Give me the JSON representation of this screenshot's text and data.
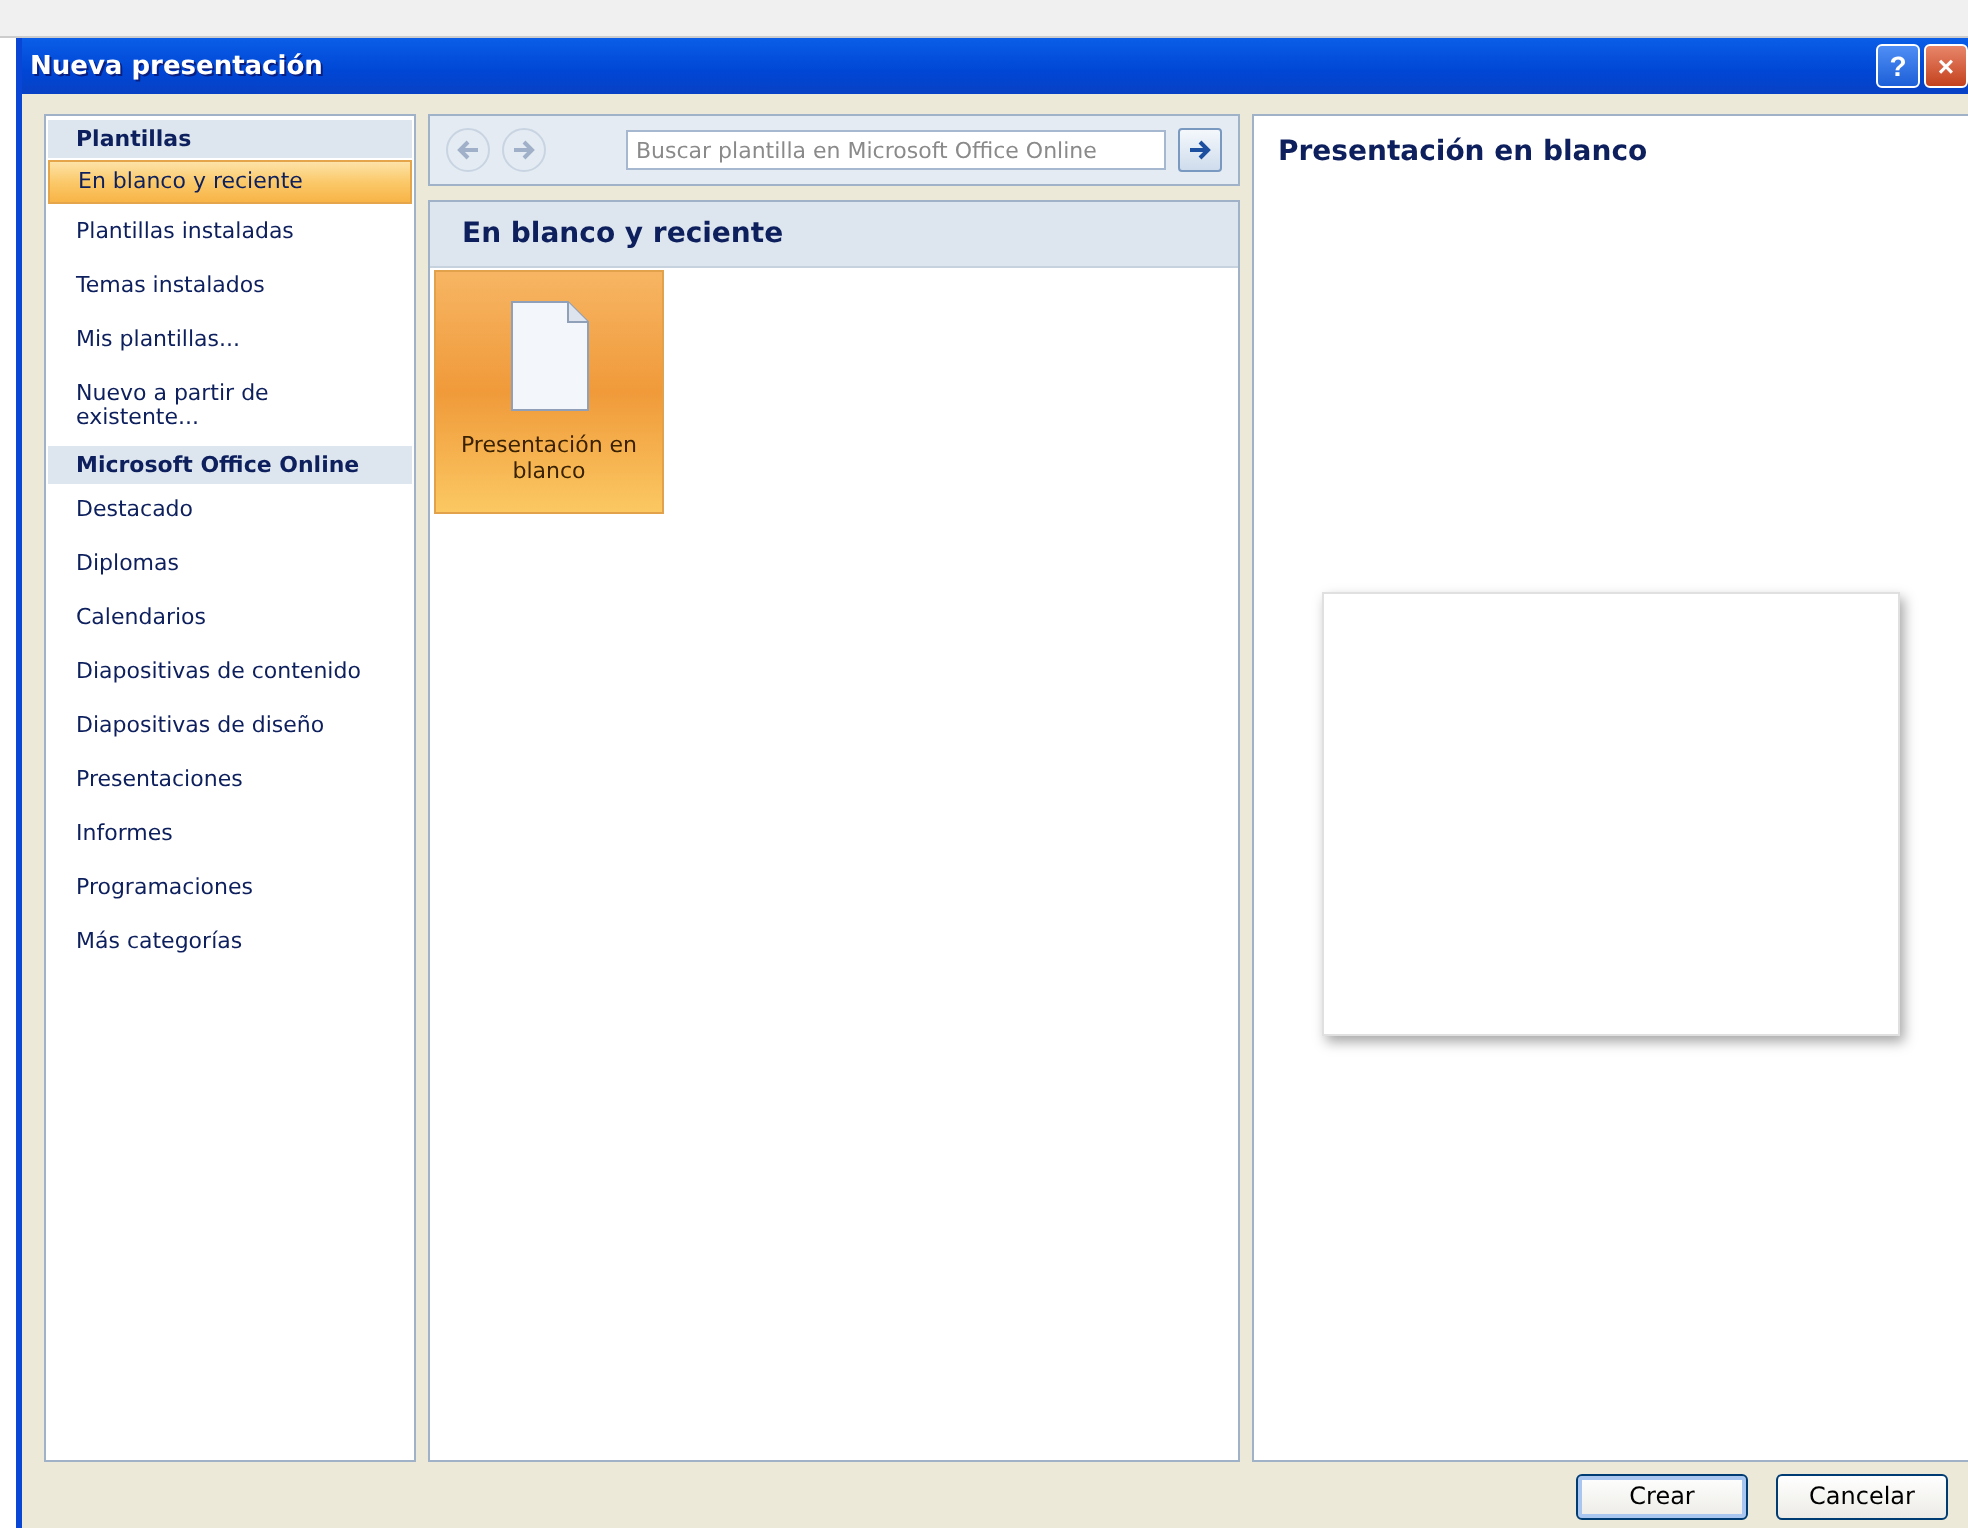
{
  "window": {
    "title": "Nueva presentación",
    "help": "?",
    "close": "×"
  },
  "sidebar": {
    "items": [
      {
        "kind": "header",
        "label": "Plantillas"
      },
      {
        "kind": "item",
        "label": "En blanco y reciente",
        "selected": true
      },
      {
        "kind": "item",
        "label": "Plantillas instaladas",
        "selected": false
      },
      {
        "kind": "item",
        "label": "Temas instalados",
        "selected": false
      },
      {
        "kind": "item",
        "label": "Mis plantillas...",
        "selected": false
      },
      {
        "kind": "item",
        "label": "Nuevo a partir de existente...",
        "selected": false
      },
      {
        "kind": "header",
        "label": "Microsoft Office Online"
      },
      {
        "kind": "item",
        "label": "Destacado",
        "selected": false
      },
      {
        "kind": "item",
        "label": "Diplomas",
        "selected": false
      },
      {
        "kind": "item",
        "label": "Calendarios",
        "selected": false
      },
      {
        "kind": "item",
        "label": "Diapositivas de contenido",
        "selected": false
      },
      {
        "kind": "item",
        "label": "Diapositivas de diseño",
        "selected": false
      },
      {
        "kind": "item",
        "label": "Presentaciones",
        "selected": false
      },
      {
        "kind": "item",
        "label": "Informes",
        "selected": false
      },
      {
        "kind": "item",
        "label": "Programaciones",
        "selected": false
      },
      {
        "kind": "item",
        "label": "Más categorías",
        "selected": false
      }
    ]
  },
  "search": {
    "placeholder": "Buscar plantilla en Microsoft Office Online"
  },
  "gallery": {
    "heading": "En blanco y reciente",
    "templates": [
      {
        "label": "Presentación en blanco",
        "selected": true
      }
    ]
  },
  "preview": {
    "title": "Presentación en blanco"
  },
  "buttons": [
    "Crear",
    "Cancelar"
  ]
}
